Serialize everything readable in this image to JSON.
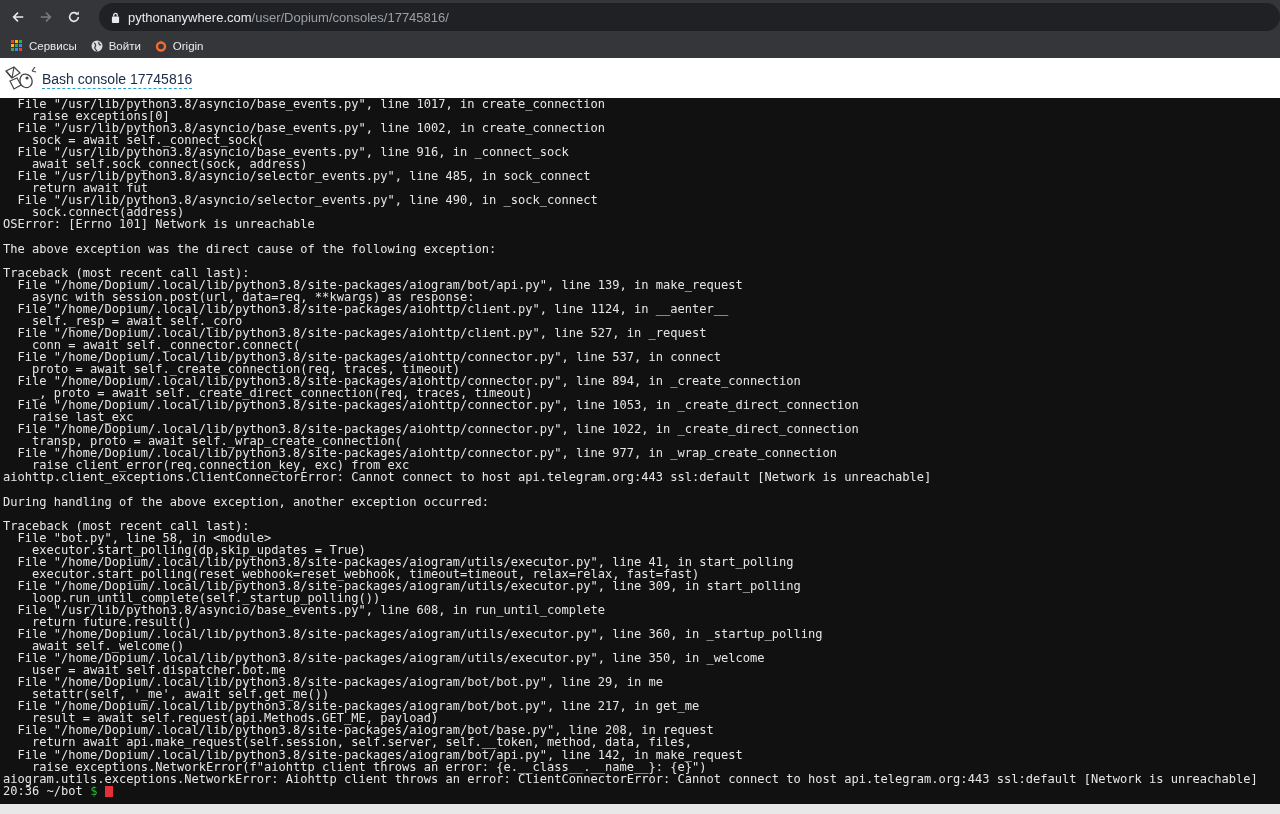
{
  "browser": {
    "url_host": "pythonanywhere.com",
    "url_path": "/user/Dopium/consoles/17745816/",
    "bookmarks": [
      {
        "kind": "apps",
        "label": "Сервисы"
      },
      {
        "kind": "globe",
        "label": "Войти"
      },
      {
        "kind": "origin",
        "label": "Origin"
      }
    ]
  },
  "console": {
    "title": "Bash console 17745816",
    "blocks": [
      [
        "  File \"/usr/lib/python3.8/asyncio/base_events.py\", line 1017, in create_connection",
        "    raise exceptions[0]",
        "  File \"/usr/lib/python3.8/asyncio/base_events.py\", line 1002, in create_connection",
        "    sock = await self._connect_sock(",
        "  File \"/usr/lib/python3.8/asyncio/base_events.py\", line 916, in _connect_sock",
        "    await self.sock_connect(sock, address)",
        "  File \"/usr/lib/python3.8/asyncio/selector_events.py\", line 485, in sock_connect",
        "    return await fut",
        "  File \"/usr/lib/python3.8/asyncio/selector_events.py\", line 490, in _sock_connect",
        "    sock.connect(address)",
        "OSError: [Errno 101] Network is unreachable"
      ],
      [
        "The above exception was the direct cause of the following exception:"
      ],
      [
        "Traceback (most recent call last):",
        "  File \"/home/Dopium/.local/lib/python3.8/site-packages/aiogram/bot/api.py\", line 139, in make_request",
        "    async with session.post(url, data=req, **kwargs) as response:",
        "  File \"/home/Dopium/.local/lib/python3.8/site-packages/aiohttp/client.py\", line 1124, in __aenter__",
        "    self._resp = await self._coro",
        "  File \"/home/Dopium/.local/lib/python3.8/site-packages/aiohttp/client.py\", line 527, in _request",
        "    conn = await self._connector.connect(",
        "  File \"/home/Dopium/.local/lib/python3.8/site-packages/aiohttp/connector.py\", line 537, in connect",
        "    proto = await self._create_connection(req, traces, timeout)",
        "  File \"/home/Dopium/.local/lib/python3.8/site-packages/aiohttp/connector.py\", line 894, in _create_connection",
        "    _, proto = await self._create_direct_connection(req, traces, timeout)",
        "  File \"/home/Dopium/.local/lib/python3.8/site-packages/aiohttp/connector.py\", line 1053, in _create_direct_connection",
        "    raise last_exc",
        "  File \"/home/Dopium/.local/lib/python3.8/site-packages/aiohttp/connector.py\", line 1022, in _create_direct_connection",
        "    transp, proto = await self._wrap_create_connection(",
        "  File \"/home/Dopium/.local/lib/python3.8/site-packages/aiohttp/connector.py\", line 977, in _wrap_create_connection",
        "    raise client_error(req.connection_key, exc) from exc",
        "aiohttp.client_exceptions.ClientConnectorError: Cannot connect to host api.telegram.org:443 ssl:default [Network is unreachable]"
      ],
      [
        "During handling of the above exception, another exception occurred:"
      ],
      [
        "Traceback (most recent call last):",
        "  File \"bot.py\", line 58, in <module>",
        "    executor.start_polling(dp,skip_updates = True)",
        "  File \"/home/Dopium/.local/lib/python3.8/site-packages/aiogram/utils/executor.py\", line 41, in start_polling",
        "    executor.start_polling(reset_webhook=reset_webhook, timeout=timeout, relax=relax, fast=fast)",
        "  File \"/home/Dopium/.local/lib/python3.8/site-packages/aiogram/utils/executor.py\", line 309, in start_polling",
        "    loop.run_until_complete(self._startup_polling())",
        "  File \"/usr/lib/python3.8/asyncio/base_events.py\", line 608, in run_until_complete",
        "    return future.result()",
        "  File \"/home/Dopium/.local/lib/python3.8/site-packages/aiogram/utils/executor.py\", line 360, in _startup_polling",
        "    await self._welcome()",
        "  File \"/home/Dopium/.local/lib/python3.8/site-packages/aiogram/utils/executor.py\", line 350, in _welcome",
        "    user = await self.dispatcher.bot.me",
        "  File \"/home/Dopium/.local/lib/python3.8/site-packages/aiogram/bot/bot.py\", line 29, in me",
        "    setattr(self, '_me', await self.get_me())",
        "  File \"/home/Dopium/.local/lib/python3.8/site-packages/aiogram/bot/bot.py\", line 217, in get_me",
        "    result = await self.request(api.Methods.GET_ME, payload)",
        "  File \"/home/Dopium/.local/lib/python3.8/site-packages/aiogram/bot/base.py\", line 208, in request",
        "    return await api.make_request(self.session, self.server, self.__token, method, data, files,",
        "  File \"/home/Dopium/.local/lib/python3.8/site-packages/aiogram/bot/api.py\", line 142, in make_request",
        "    raise exceptions.NetworkError(f\"aiohttp client throws an error: {e.__class__.__name__}: {e}\")",
        "aiogram.utils.exceptions.NetworkError: Aiohttp client throws an error: ClientConnectorError: Cannot connect to host api.telegram.org:443 ssl:default [Network is unreachable]"
      ]
    ],
    "prompt": {
      "time": "20:36",
      "dir": "~/bot",
      "symbol": "$"
    }
  }
}
